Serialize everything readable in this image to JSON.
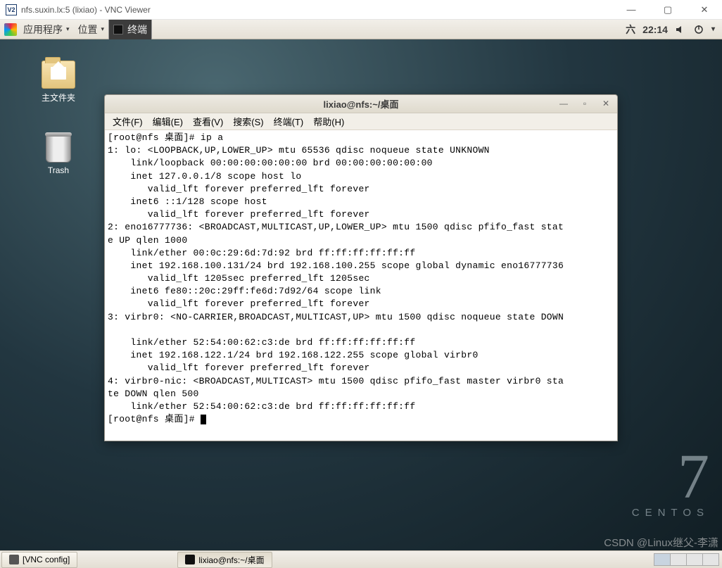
{
  "vnc": {
    "title": "nfs.suxin.lx:5 (lixiao) - VNC Viewer",
    "logo": "V2"
  },
  "panel": {
    "applications": "应用程序",
    "places": "位置",
    "running_app": "终端",
    "day": "六",
    "time": "22:14"
  },
  "desktop": {
    "home": "主文件夹",
    "trash": "Trash"
  },
  "centos": {
    "seven": "7",
    "name": "CENTOS"
  },
  "watermark": "CSDN @Linux继父-李潇",
  "terminal_window": {
    "title": "lixiao@nfs:~/桌面",
    "menu": {
      "file": "文件(F)",
      "edit": "编辑(E)",
      "view": "查看(V)",
      "search": "搜索(S)",
      "terminal": "终端(T)",
      "help": "帮助(H)"
    },
    "output": "[root@nfs 桌面]# ip a\n1: lo: <LOOPBACK,UP,LOWER_UP> mtu 65536 qdisc noqueue state UNKNOWN \n    link/loopback 00:00:00:00:00:00 brd 00:00:00:00:00:00\n    inet 127.0.0.1/8 scope host lo\n       valid_lft forever preferred_lft forever\n    inet6 ::1/128 scope host \n       valid_lft forever preferred_lft forever\n2: eno16777736: <BROADCAST,MULTICAST,UP,LOWER_UP> mtu 1500 qdisc pfifo_fast stat\ne UP qlen 1000\n    link/ether 00:0c:29:6d:7d:92 brd ff:ff:ff:ff:ff:ff\n    inet 192.168.100.131/24 brd 192.168.100.255 scope global dynamic eno16777736\n       valid_lft 1205sec preferred_lft 1205sec\n    inet6 fe80::20c:29ff:fe6d:7d92/64 scope link \n       valid_lft forever preferred_lft forever\n3: virbr0: <NO-CARRIER,BROADCAST,MULTICAST,UP> mtu 1500 qdisc noqueue state DOWN\n \n    link/ether 52:54:00:62:c3:de brd ff:ff:ff:ff:ff:ff\n    inet 192.168.122.1/24 brd 192.168.122.255 scope global virbr0\n       valid_lft forever preferred_lft forever\n4: virbr0-nic: <BROADCAST,MULTICAST> mtu 1500 qdisc pfifo_fast master virbr0 sta\nte DOWN qlen 500\n    link/ether 52:54:00:62:c3:de brd ff:ff:ff:ff:ff:ff\n[root@nfs 桌面]# "
  },
  "taskbar": {
    "item1": "[VNC config]",
    "item2": "lixiao@nfs:~/桌面"
  }
}
